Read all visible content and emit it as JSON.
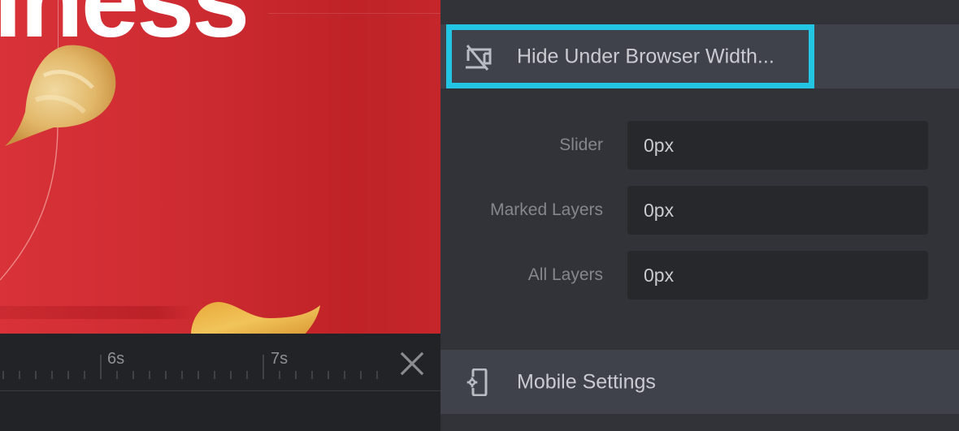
{
  "canvas": {
    "headline_text": "iness",
    "background_color": "#cc2b31"
  },
  "timeline": {
    "tick_labels": [
      "6s",
      "7s"
    ],
    "close_label": "close timeline"
  },
  "panel": {
    "hide_section": {
      "label": "Hide Under Browser Width...",
      "icon": "hide-desktop-icon",
      "highlight_color": "#22c5e3"
    },
    "fields": [
      {
        "label": "Slider",
        "value": "0px"
      },
      {
        "label": "Marked Layers",
        "value": "0px"
      },
      {
        "label": "All Layers",
        "value": "0px"
      }
    ],
    "mobile_section": {
      "label": "Mobile Settings",
      "icon": "mobile-settings-icon"
    }
  }
}
